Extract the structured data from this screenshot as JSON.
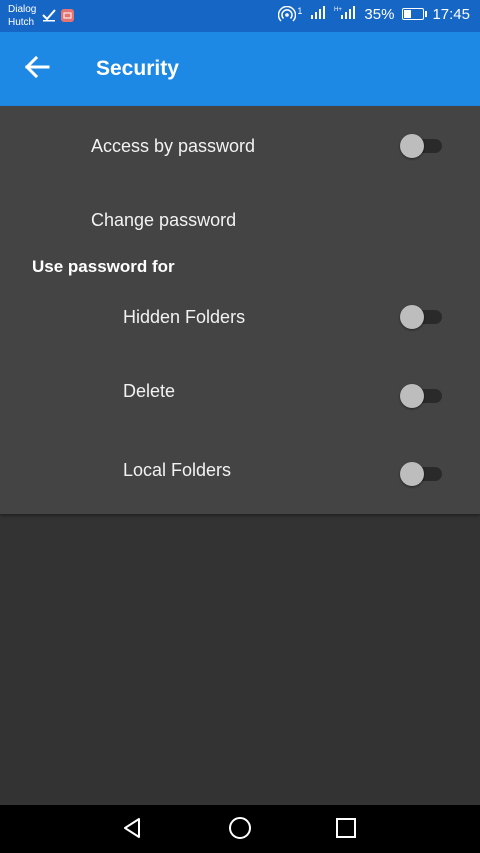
{
  "status_bar": {
    "carrier_line1": "Dialog",
    "carrier_line2": "Hutch",
    "signal_badge": "1",
    "battery": "35%",
    "battery_level": 0.35,
    "time": "17:45"
  },
  "app_bar": {
    "title": "Security",
    "back_icon": "arrow-left-icon"
  },
  "settings": {
    "access_by_password": {
      "label": "Access by password",
      "enabled": false
    },
    "change_password": {
      "label": "Change password"
    },
    "section_header": "Use password for",
    "items": [
      {
        "label": "Hidden Folders",
        "enabled": false
      },
      {
        "label": "Delete",
        "enabled": false
      },
      {
        "label": "Local Folders",
        "enabled": false
      }
    ]
  },
  "nav_bar": {
    "icons": [
      "back-triangle-icon",
      "home-circle-icon",
      "recents-square-icon"
    ]
  },
  "colors": {
    "status_bar": "#1666c6",
    "app_bar": "#1e88e5",
    "panel": "#444444",
    "background": "#333333"
  }
}
